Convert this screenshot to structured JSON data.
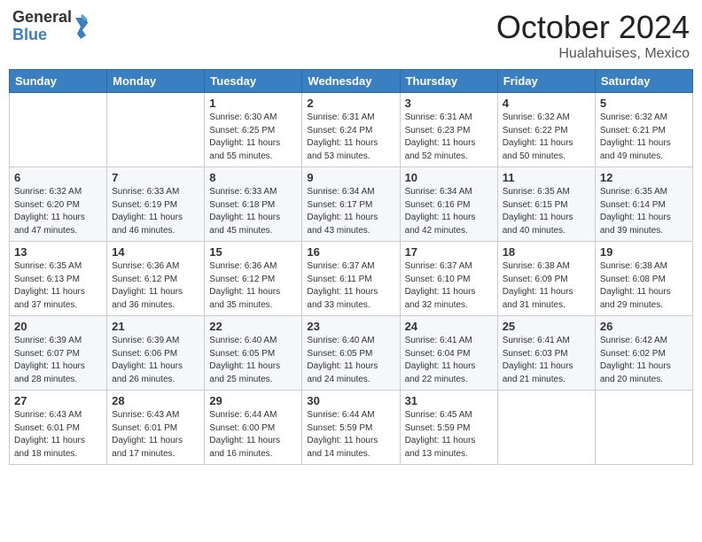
{
  "header": {
    "logo": {
      "line1": "General",
      "line2": "Blue"
    },
    "month": "October 2024",
    "location": "Hualahuises, Mexico"
  },
  "days_of_week": [
    "Sunday",
    "Monday",
    "Tuesday",
    "Wednesday",
    "Thursday",
    "Friday",
    "Saturday"
  ],
  "weeks": [
    [
      {
        "day": "",
        "info": ""
      },
      {
        "day": "",
        "info": ""
      },
      {
        "day": "1",
        "info": "Sunrise: 6:30 AM\nSunset: 6:25 PM\nDaylight: 11 hours\nand 55 minutes."
      },
      {
        "day": "2",
        "info": "Sunrise: 6:31 AM\nSunset: 6:24 PM\nDaylight: 11 hours\nand 53 minutes."
      },
      {
        "day": "3",
        "info": "Sunrise: 6:31 AM\nSunset: 6:23 PM\nDaylight: 11 hours\nand 52 minutes."
      },
      {
        "day": "4",
        "info": "Sunrise: 6:32 AM\nSunset: 6:22 PM\nDaylight: 11 hours\nand 50 minutes."
      },
      {
        "day": "5",
        "info": "Sunrise: 6:32 AM\nSunset: 6:21 PM\nDaylight: 11 hours\nand 49 minutes."
      }
    ],
    [
      {
        "day": "6",
        "info": "Sunrise: 6:32 AM\nSunset: 6:20 PM\nDaylight: 11 hours\nand 47 minutes."
      },
      {
        "day": "7",
        "info": "Sunrise: 6:33 AM\nSunset: 6:19 PM\nDaylight: 11 hours\nand 46 minutes."
      },
      {
        "day": "8",
        "info": "Sunrise: 6:33 AM\nSunset: 6:18 PM\nDaylight: 11 hours\nand 45 minutes."
      },
      {
        "day": "9",
        "info": "Sunrise: 6:34 AM\nSunset: 6:17 PM\nDaylight: 11 hours\nand 43 minutes."
      },
      {
        "day": "10",
        "info": "Sunrise: 6:34 AM\nSunset: 6:16 PM\nDaylight: 11 hours\nand 42 minutes."
      },
      {
        "day": "11",
        "info": "Sunrise: 6:35 AM\nSunset: 6:15 PM\nDaylight: 11 hours\nand 40 minutes."
      },
      {
        "day": "12",
        "info": "Sunrise: 6:35 AM\nSunset: 6:14 PM\nDaylight: 11 hours\nand 39 minutes."
      }
    ],
    [
      {
        "day": "13",
        "info": "Sunrise: 6:35 AM\nSunset: 6:13 PM\nDaylight: 11 hours\nand 37 minutes."
      },
      {
        "day": "14",
        "info": "Sunrise: 6:36 AM\nSunset: 6:12 PM\nDaylight: 11 hours\nand 36 minutes."
      },
      {
        "day": "15",
        "info": "Sunrise: 6:36 AM\nSunset: 6:12 PM\nDaylight: 11 hours\nand 35 minutes."
      },
      {
        "day": "16",
        "info": "Sunrise: 6:37 AM\nSunset: 6:11 PM\nDaylight: 11 hours\nand 33 minutes."
      },
      {
        "day": "17",
        "info": "Sunrise: 6:37 AM\nSunset: 6:10 PM\nDaylight: 11 hours\nand 32 minutes."
      },
      {
        "day": "18",
        "info": "Sunrise: 6:38 AM\nSunset: 6:09 PM\nDaylight: 11 hours\nand 31 minutes."
      },
      {
        "day": "19",
        "info": "Sunrise: 6:38 AM\nSunset: 6:08 PM\nDaylight: 11 hours\nand 29 minutes."
      }
    ],
    [
      {
        "day": "20",
        "info": "Sunrise: 6:39 AM\nSunset: 6:07 PM\nDaylight: 11 hours\nand 28 minutes."
      },
      {
        "day": "21",
        "info": "Sunrise: 6:39 AM\nSunset: 6:06 PM\nDaylight: 11 hours\nand 26 minutes."
      },
      {
        "day": "22",
        "info": "Sunrise: 6:40 AM\nSunset: 6:05 PM\nDaylight: 11 hours\nand 25 minutes."
      },
      {
        "day": "23",
        "info": "Sunrise: 6:40 AM\nSunset: 6:05 PM\nDaylight: 11 hours\nand 24 minutes."
      },
      {
        "day": "24",
        "info": "Sunrise: 6:41 AM\nSunset: 6:04 PM\nDaylight: 11 hours\nand 22 minutes."
      },
      {
        "day": "25",
        "info": "Sunrise: 6:41 AM\nSunset: 6:03 PM\nDaylight: 11 hours\nand 21 minutes."
      },
      {
        "day": "26",
        "info": "Sunrise: 6:42 AM\nSunset: 6:02 PM\nDaylight: 11 hours\nand 20 minutes."
      }
    ],
    [
      {
        "day": "27",
        "info": "Sunrise: 6:43 AM\nSunset: 6:01 PM\nDaylight: 11 hours\nand 18 minutes."
      },
      {
        "day": "28",
        "info": "Sunrise: 6:43 AM\nSunset: 6:01 PM\nDaylight: 11 hours\nand 17 minutes."
      },
      {
        "day": "29",
        "info": "Sunrise: 6:44 AM\nSunset: 6:00 PM\nDaylight: 11 hours\nand 16 minutes."
      },
      {
        "day": "30",
        "info": "Sunrise: 6:44 AM\nSunset: 5:59 PM\nDaylight: 11 hours\nand 14 minutes."
      },
      {
        "day": "31",
        "info": "Sunrise: 6:45 AM\nSunset: 5:59 PM\nDaylight: 11 hours\nand 13 minutes."
      },
      {
        "day": "",
        "info": ""
      },
      {
        "day": "",
        "info": ""
      }
    ]
  ]
}
